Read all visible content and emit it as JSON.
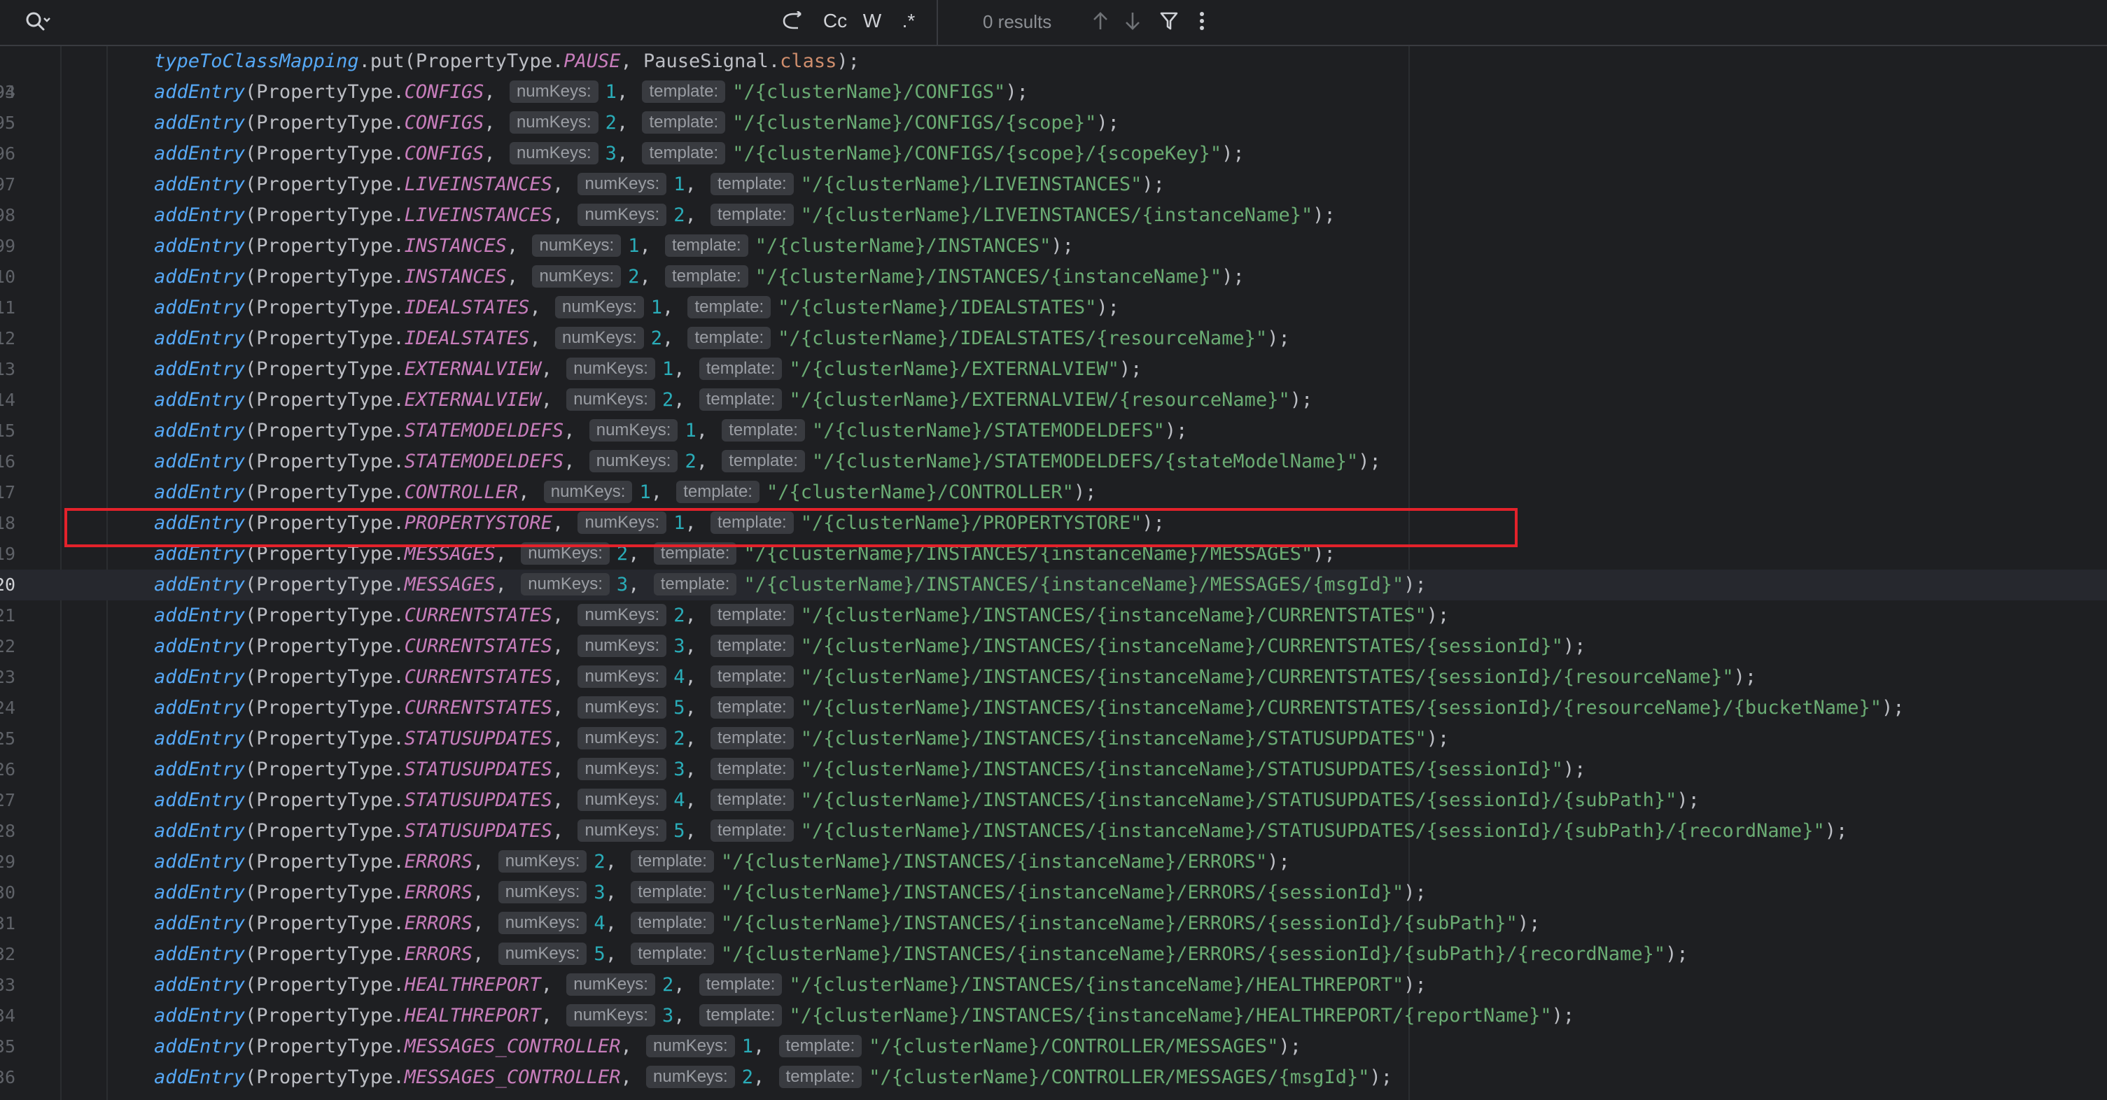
{
  "findbar": {
    "results_text": "0 results",
    "buttons": {
      "wrap": "wrap-icon",
      "match_case": "Cc",
      "words": "W",
      "regex": ".*"
    }
  },
  "editor": {
    "line_numbers": [
      "93",
      "94",
      "95",
      "96",
      "97",
      "98",
      "99",
      "10",
      "11",
      "12",
      "13",
      "14",
      "15",
      "16",
      "17",
      "18",
      "19",
      "20",
      "21",
      "22",
      "23",
      "24",
      "25",
      "26",
      "27",
      "28",
      "29",
      "30",
      "31",
      "32",
      "33",
      "34",
      "35",
      "36"
    ],
    "first_line": {
      "method": "typeToClassMapping",
      "call": ".put(PropertyType.",
      "field": "PAUSE",
      "mid": ", PauseSignal.",
      "keyword": "class",
      "end": ");"
    },
    "hint_numkeys": "numKeys:",
    "hint_template": "template:",
    "entries": [
      {
        "ln": "94",
        "field": "CONFIGS",
        "num": "1",
        "str": "\"/{clusterName}/CONFIGS\""
      },
      {
        "ln": "95",
        "field": "CONFIGS",
        "num": "2",
        "str": "\"/{clusterName}/CONFIGS/{scope}\""
      },
      {
        "ln": "96",
        "field": "CONFIGS",
        "num": "3",
        "str": "\"/{clusterName}/CONFIGS/{scope}/{scopeKey}\""
      },
      {
        "ln": "97",
        "field": "LIVEINSTANCES",
        "num": "1",
        "str": "\"/{clusterName}/LIVEINSTANCES\""
      },
      {
        "ln": "98",
        "field": "LIVEINSTANCES",
        "num": "2",
        "str": "\"/{clusterName}/LIVEINSTANCES/{instanceName}\""
      },
      {
        "ln": "99",
        "field": "INSTANCES",
        "num": "1",
        "str": "\"/{clusterName}/INSTANCES\""
      },
      {
        "ln": "10",
        "field": "INSTANCES",
        "num": "2",
        "str": "\"/{clusterName}/INSTANCES/{instanceName}\""
      },
      {
        "ln": "11",
        "field": "IDEALSTATES",
        "num": "1",
        "str": "\"/{clusterName}/IDEALSTATES\""
      },
      {
        "ln": "12",
        "field": "IDEALSTATES",
        "num": "2",
        "str": "\"/{clusterName}/IDEALSTATES/{resourceName}\""
      },
      {
        "ln": "13",
        "field": "EXTERNALVIEW",
        "num": "1",
        "str": "\"/{clusterName}/EXTERNALVIEW\""
      },
      {
        "ln": "14",
        "field": "EXTERNALVIEW",
        "num": "2",
        "str": "\"/{clusterName}/EXTERNALVIEW/{resourceName}\""
      },
      {
        "ln": "15",
        "field": "STATEMODELDEFS",
        "num": "1",
        "str": "\"/{clusterName}/STATEMODELDEFS\""
      },
      {
        "ln": "16",
        "field": "STATEMODELDEFS",
        "num": "2",
        "str": "\"/{clusterName}/STATEMODELDEFS/{stateModelName}\""
      },
      {
        "ln": "17",
        "field": "CONTROLLER",
        "num": "1",
        "str": "\"/{clusterName}/CONTROLLER\""
      },
      {
        "ln": "18",
        "field": "PROPERTYSTORE",
        "num": "1",
        "str": "\"/{clusterName}/PROPERTYSTORE\""
      },
      {
        "ln": "19",
        "field": "MESSAGES",
        "num": "2",
        "str": "\"/{clusterName}/INSTANCES/{instanceName}/MESSAGES\""
      },
      {
        "ln": "20",
        "field": "MESSAGES",
        "num": "3",
        "str": "\"/{clusterName}/INSTANCES/{instanceName}/MESSAGES/{msgId}\""
      },
      {
        "ln": "21",
        "field": "CURRENTSTATES",
        "num": "2",
        "str": "\"/{clusterName}/INSTANCES/{instanceName}/CURRENTSTATES\""
      },
      {
        "ln": "22",
        "field": "CURRENTSTATES",
        "num": "3",
        "str": "\"/{clusterName}/INSTANCES/{instanceName}/CURRENTSTATES/{sessionId}\""
      },
      {
        "ln": "23",
        "field": "CURRENTSTATES",
        "num": "4",
        "str": "\"/{clusterName}/INSTANCES/{instanceName}/CURRENTSTATES/{sessionId}/{resourceName}\""
      },
      {
        "ln": "24",
        "field": "CURRENTSTATES",
        "num": "5",
        "str": "\"/{clusterName}/INSTANCES/{instanceName}/CURRENTSTATES/{sessionId}/{resourceName}/{bucketName}\""
      },
      {
        "ln": "25",
        "field": "STATUSUPDATES",
        "num": "2",
        "str": "\"/{clusterName}/INSTANCES/{instanceName}/STATUSUPDATES\""
      },
      {
        "ln": "26",
        "field": "STATUSUPDATES",
        "num": "3",
        "str": "\"/{clusterName}/INSTANCES/{instanceName}/STATUSUPDATES/{sessionId}\""
      },
      {
        "ln": "27",
        "field": "STATUSUPDATES",
        "num": "4",
        "str": "\"/{clusterName}/INSTANCES/{instanceName}/STATUSUPDATES/{sessionId}/{subPath}\""
      },
      {
        "ln": "28",
        "field": "STATUSUPDATES",
        "num": "5",
        "str": "\"/{clusterName}/INSTANCES/{instanceName}/STATUSUPDATES/{sessionId}/{subPath}/{recordName}\""
      },
      {
        "ln": "29",
        "field": "ERRORS",
        "num": "2",
        "str": "\"/{clusterName}/INSTANCES/{instanceName}/ERRORS\""
      },
      {
        "ln": "30",
        "field": "ERRORS",
        "num": "3",
        "str": "\"/{clusterName}/INSTANCES/{instanceName}/ERRORS/{sessionId}\""
      },
      {
        "ln": "31",
        "field": "ERRORS",
        "num": "4",
        "str": "\"/{clusterName}/INSTANCES/{instanceName}/ERRORS/{sessionId}/{subPath}\""
      },
      {
        "ln": "32",
        "field": "ERRORS",
        "num": "5",
        "str": "\"/{clusterName}/INSTANCES/{instanceName}/ERRORS/{sessionId}/{subPath}/{recordName}\""
      },
      {
        "ln": "33",
        "field": "HEALTHREPORT",
        "num": "2",
        "str": "\"/{clusterName}/INSTANCES/{instanceName}/HEALTHREPORT\""
      },
      {
        "ln": "34",
        "field": "HEALTHREPORT",
        "num": "3",
        "str": "\"/{clusterName}/INSTANCES/{instanceName}/HEALTHREPORT/{reportName}\""
      },
      {
        "ln": "35",
        "field": "MESSAGES_CONTROLLER",
        "num": "1",
        "str": "\"/{clusterName}/CONTROLLER/MESSAGES\""
      },
      {
        "ln": "36",
        "field": "MESSAGES_CONTROLLER",
        "num": "2",
        "str": "\"/{clusterName}/CONTROLLER/MESSAGES/{msgId}\""
      }
    ],
    "method_name": "addEntry",
    "open_call": "(PropertyType.",
    "comma": ",",
    "close": ");",
    "current_line": "20",
    "highlighted_line": "18",
    "colors": {
      "background": "#1e1f22",
      "method": "#56a8f5",
      "field": "#c77dbb",
      "number": "#2aacb8",
      "string": "#6aab73",
      "keyword": "#cf8e6d",
      "highlight_box": "#e3222b"
    }
  }
}
